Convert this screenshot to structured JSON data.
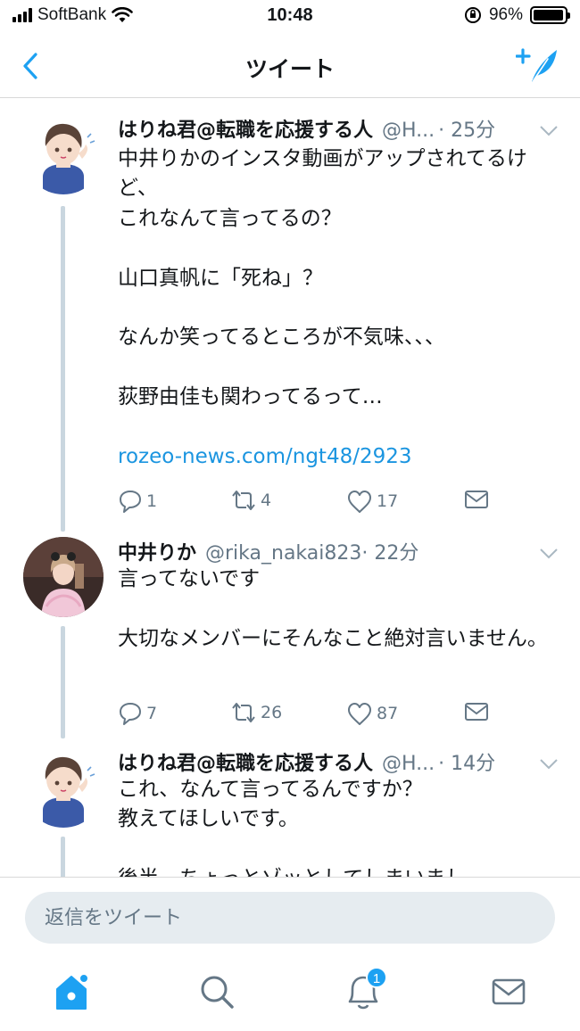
{
  "status_bar": {
    "carrier": "SoftBank",
    "time": "10:48",
    "battery": "96%",
    "battery_level": 0.96
  },
  "nav": {
    "title": "ツイート",
    "back_icon": "chevron-left-icon",
    "compose_icon": "compose-feather-icon"
  },
  "colors": {
    "accent": "#1da1f2",
    "link": "#1b95e0",
    "muted": "#657786",
    "thread_line": "#c9d6df"
  },
  "tweets": [
    {
      "name": "はりね君@転職を応援する人",
      "handle": "@H...",
      "time": "· 25分",
      "paragraphs": [
        "中井りかのインスタ動画がアップされてるけど、\nこれなんて言ってるの？",
        "山口真帆に「死ね」？",
        "なんか笑ってるところが不気味、、、",
        "荻野由佳も関わってるって…"
      ],
      "link": "rozeo-news.com/ngt48/2923",
      "replies": "1",
      "retweets": "4",
      "likes": "17"
    },
    {
      "name": "中井りか",
      "handle": "@rika_nakai823",
      "time": "· 22分",
      "paragraphs": [
        "言ってないです",
        "大切なメンバーにそんなこと絶対言いません。"
      ],
      "replies": "7",
      "retweets": "26",
      "likes": "87"
    },
    {
      "name": "はりね君@転職を応援する人",
      "handle": "@H...",
      "time": "· 14分",
      "paragraphs": [
        "これ、なんて言ってるんですか？\n教えてほしいです。",
        "後半、ちょっとゾッとしてしまいまし"
      ]
    }
  ],
  "reply_bar": {
    "placeholder": "返信をツイート"
  },
  "tab_bar": {
    "items": [
      "home-icon",
      "search-icon",
      "notifications-icon",
      "messages-icon"
    ],
    "notification_count": "1"
  }
}
